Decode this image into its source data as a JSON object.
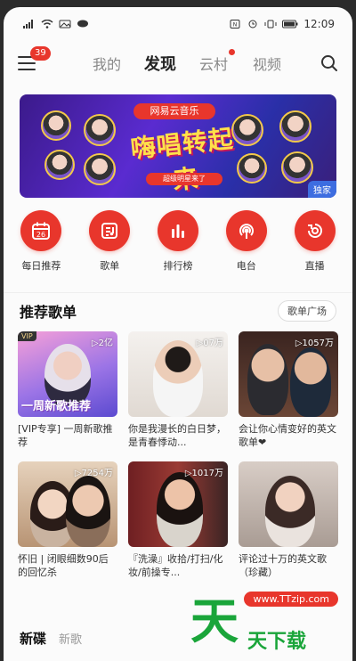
{
  "status_bar": {
    "time": "12:09"
  },
  "nav": {
    "badge_count": "39",
    "tabs": [
      {
        "label": "我的",
        "active": false
      },
      {
        "label": "发现",
        "active": true
      },
      {
        "label": "云村",
        "active": false,
        "dot": true
      },
      {
        "label": "视频",
        "active": false
      }
    ]
  },
  "banner": {
    "logo": "网易云音乐",
    "title": "嗨唱转起来",
    "subtitle": "超级明星来了",
    "tag": "独家"
  },
  "quick_actions": [
    {
      "label": "每日推荐",
      "icon": "calendar-icon",
      "day": "26"
    },
    {
      "label": "歌单",
      "icon": "playlist-icon"
    },
    {
      "label": "排行榜",
      "icon": "chart-bars-icon"
    },
    {
      "label": "电台",
      "icon": "radio-icon"
    },
    {
      "label": "直播",
      "icon": "live-icon"
    }
  ],
  "recommend": {
    "title": "推荐歌单",
    "more_button": "歌单广场",
    "playlists": [
      {
        "title": "[VIP专享] 一周新歌推荐",
        "plays": "2亿",
        "caption": "一周新歌推荐",
        "vip": true,
        "bg": "#8a6bd8"
      },
      {
        "title": "你是我漫长的白日梦，是青春悸动...",
        "plays": "07万",
        "bg": "#e9e4df"
      },
      {
        "title": "会让你心情变好的英文歌单❤",
        "plays": "1057万",
        "bg": "#5a3a2e"
      },
      {
        "title": "怀旧 | 闭眼细数90后的回忆杀",
        "plays": "7254万",
        "bg": "#c8a98a"
      },
      {
        "title": "『洗澡』收拾/打扫/化妆/前操专...",
        "plays": "1017万",
        "bg": "#7a2a2a"
      },
      {
        "title": "评论过十万的英文歌（珍藏）",
        "plays": "",
        "bg": "#b8a8a0"
      }
    ]
  },
  "bottom": {
    "tab_primary": "新碟",
    "tab_secondary": "新歌"
  },
  "watermark": {
    "url": "www.TTzip.com",
    "big": "天",
    "text": "天下载"
  },
  "colors": {
    "accent": "#e8362c",
    "watermark": "#1aa53a"
  }
}
